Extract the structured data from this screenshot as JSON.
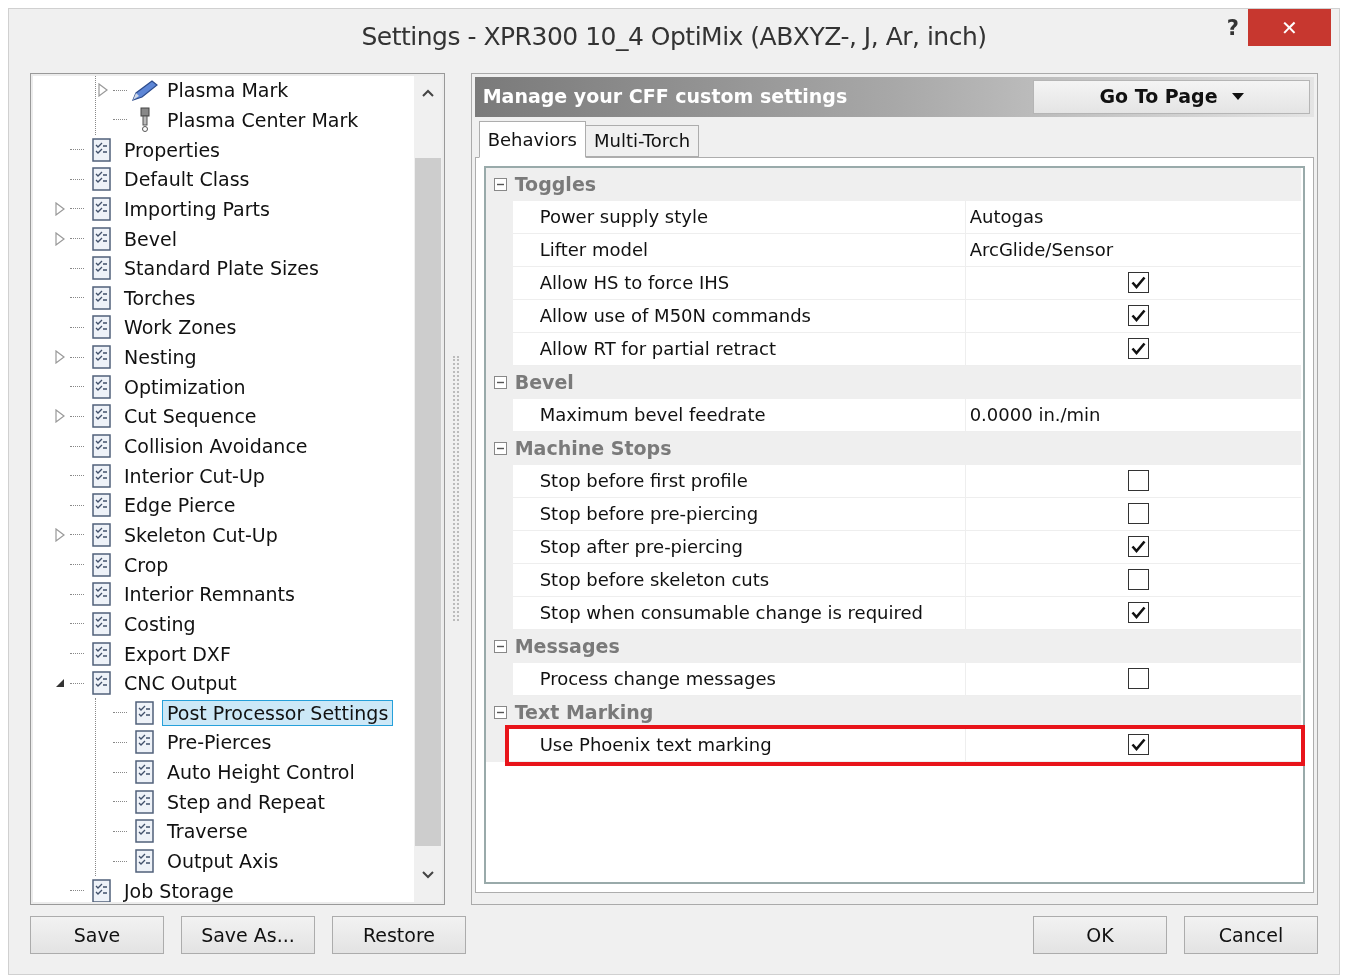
{
  "window": {
    "title": "Settings - XPR300 10_4 OptiMix (ABXYZ-, J, Ar, inch)",
    "help": "?",
    "close": "✕"
  },
  "tree": [
    {
      "children": [
        {
          "label": "Plasma Mark",
          "kind": "collapsed",
          "selected": false
        },
        {
          "label": "Plasma Center Mark",
          "kind": "leaf",
          "selected": false
        }
      ]
    },
    {
      "label": "Properties",
      "kind": "leaf",
      "selected": false
    },
    {
      "label": "Default Class",
      "kind": "leaf",
      "selected": false
    },
    {
      "label": "Importing Parts",
      "kind": "collapsed",
      "selected": false
    },
    {
      "label": "Bevel",
      "kind": "collapsed",
      "selected": false
    },
    {
      "label": "Standard Plate Sizes",
      "kind": "leaf",
      "selected": false
    },
    {
      "label": "Torches",
      "kind": "leaf",
      "selected": false
    },
    {
      "label": "Work Zones",
      "kind": "leaf",
      "selected": false
    },
    {
      "label": "Nesting",
      "kind": "collapsed",
      "selected": false
    },
    {
      "label": "Optimization",
      "kind": "leaf",
      "selected": false
    },
    {
      "label": "Cut Sequence",
      "kind": "collapsed",
      "selected": false
    },
    {
      "label": "Collision Avoidance",
      "kind": "leaf",
      "selected": false
    },
    {
      "label": "Interior Cut-Up",
      "kind": "leaf",
      "selected": false
    },
    {
      "label": "Edge Pierce",
      "kind": "leaf",
      "selected": false
    },
    {
      "label": "Skeleton Cut-Up",
      "kind": "collapsed",
      "selected": false
    },
    {
      "label": "Crop",
      "kind": "leaf",
      "selected": false
    },
    {
      "label": "Interior Remnants",
      "kind": "leaf",
      "selected": false
    },
    {
      "label": "Costing",
      "kind": "leaf",
      "selected": false
    },
    {
      "label": "Export DXF",
      "kind": "leaf",
      "selected": false
    },
    {
      "label": "CNC Output",
      "kind": "expanded",
      "selected": false,
      "children": [
        {
          "label": "Post Processor Settings",
          "kind": "leaf",
          "selected": true
        },
        {
          "label": "Pre-Pierces",
          "kind": "leaf",
          "selected": false
        },
        {
          "label": "Auto Height Control",
          "kind": "leaf",
          "selected": false
        },
        {
          "label": "Step and Repeat",
          "kind": "leaf",
          "selected": false
        },
        {
          "label": "Traverse",
          "kind": "leaf",
          "selected": false
        },
        {
          "label": "Output Axis",
          "kind": "leaf",
          "selected": false
        }
      ]
    },
    {
      "label": "Job Storage",
      "kind": "leaf",
      "selected": false
    }
  ],
  "panel": {
    "header": "Manage your CFF custom settings",
    "go_to_page": "Go To Page"
  },
  "tabs": [
    {
      "label": "Behaviors",
      "selected": true
    },
    {
      "label": "Multi-Torch",
      "selected": false
    }
  ],
  "categories": [
    {
      "name": "Toggles",
      "expanded": true,
      "rows": [
        {
          "kind": "text",
          "label": "Power supply style",
          "value": "Autogas",
          "highlighted": false
        },
        {
          "kind": "text",
          "label": "Lifter model",
          "value": "ArcGlide/Sensor",
          "highlighted": false
        },
        {
          "kind": "checkbox",
          "label": "Allow HS to force IHS",
          "checked": true,
          "highlighted": false
        },
        {
          "kind": "checkbox",
          "label": "Allow use of M50N commands",
          "checked": true,
          "highlighted": false
        },
        {
          "kind": "checkbox",
          "label": "Allow RT for partial retract",
          "checked": true,
          "highlighted": false
        }
      ]
    },
    {
      "name": "Bevel",
      "expanded": true,
      "rows": [
        {
          "kind": "text",
          "label": "Maximum bevel feedrate",
          "value": "0.0000 in./min",
          "highlighted": false
        }
      ]
    },
    {
      "name": "Machine Stops",
      "expanded": true,
      "rows": [
        {
          "kind": "checkbox",
          "label": "Stop before first profile",
          "checked": false,
          "highlighted": false
        },
        {
          "kind": "checkbox",
          "label": "Stop before pre-piercing",
          "checked": false,
          "highlighted": false
        },
        {
          "kind": "checkbox",
          "label": "Stop after pre-piercing",
          "checked": true,
          "highlighted": false
        },
        {
          "kind": "checkbox",
          "label": "Stop before skeleton cuts",
          "checked": false,
          "highlighted": false
        },
        {
          "kind": "checkbox",
          "label": "Stop when consumable change is required",
          "checked": true,
          "highlighted": false
        }
      ]
    },
    {
      "name": "Messages",
      "expanded": true,
      "rows": [
        {
          "kind": "checkbox",
          "label": "Process change messages",
          "checked": false,
          "highlighted": false
        }
      ]
    },
    {
      "name": "Text Marking",
      "expanded": true,
      "rows": [
        {
          "kind": "checkbox",
          "label": "Use Phoenix text marking",
          "checked": true,
          "highlighted": true
        }
      ]
    }
  ],
  "left_buttons": [
    "Save",
    "Save As...",
    "Restore"
  ],
  "right_buttons": [
    "OK",
    "Cancel"
  ]
}
